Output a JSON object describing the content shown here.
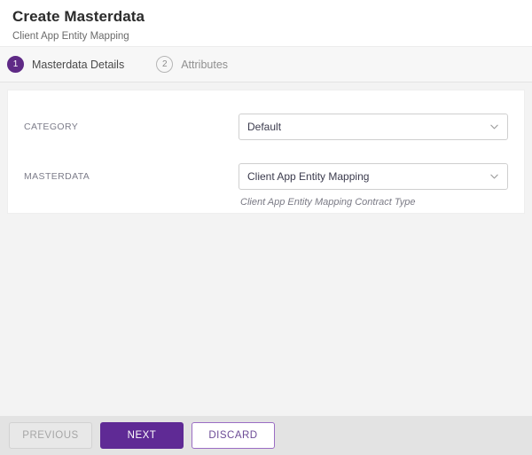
{
  "header": {
    "title": "Create Masterdata",
    "subtitle": "Client App Entity Mapping"
  },
  "stepper": {
    "steps": [
      {
        "number": "1",
        "label": "Masterdata Details",
        "state": "active"
      },
      {
        "number": "2",
        "label": "Attributes",
        "state": "inactive"
      }
    ]
  },
  "form": {
    "fields": [
      {
        "label": "CATEGORY",
        "value": "Default",
        "icon": "chevron-down-icon",
        "helper": ""
      },
      {
        "label": "MASTERDATA",
        "value": "Client App Entity Mapping",
        "icon": "chevron-down-icon",
        "helper": "Client App Entity Mapping Contract Type"
      }
    ]
  },
  "footer": {
    "previous_label": "PREVIOUS",
    "next_label": "NEXT",
    "discard_label": "DISCARD"
  },
  "colors": {
    "accent_purple": "#5f2a95",
    "step_active": "#5f2a86",
    "discard_border": "#9b6dc4",
    "page_background": "#f3f3f3",
    "footer_background": "#e3e3e3",
    "stepper_background": "#f7f7f7"
  }
}
